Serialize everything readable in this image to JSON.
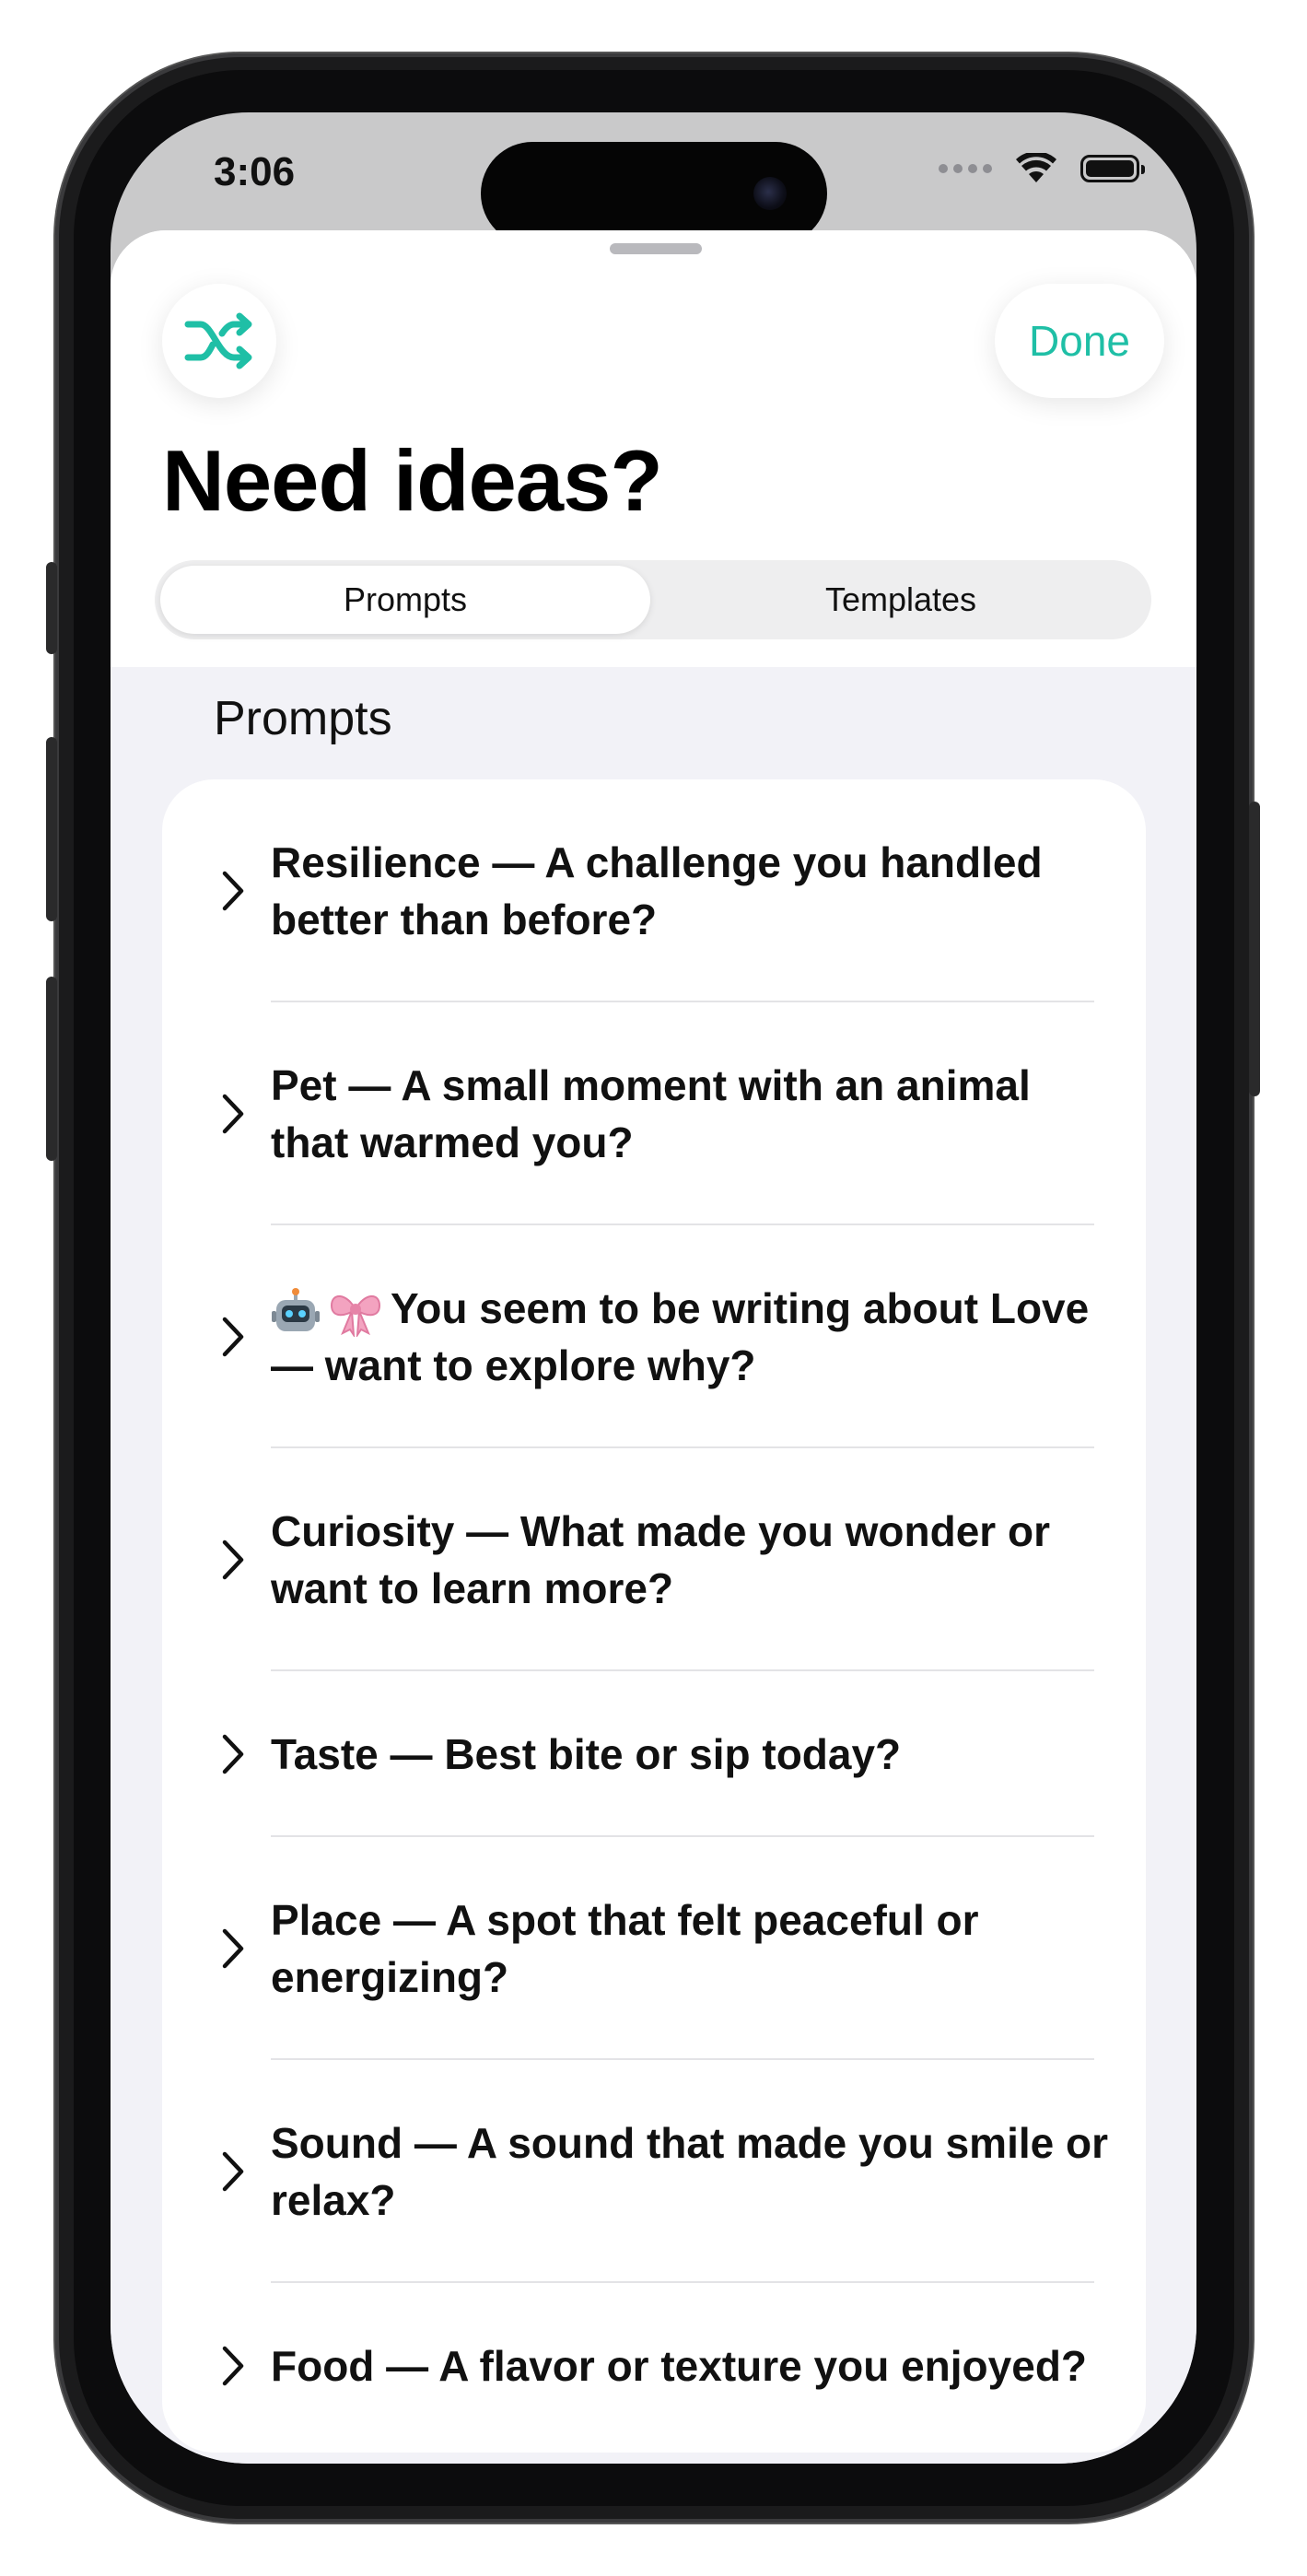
{
  "status_bar": {
    "time": "3:06"
  },
  "header": {
    "shuffle_icon": "shuffle-icon",
    "done_label": "Done",
    "title": "Need ideas?",
    "accent_color": "#1fbfa6"
  },
  "tabs": [
    {
      "label": "Prompts",
      "selected": true
    },
    {
      "label": "Templates",
      "selected": false
    }
  ],
  "section": {
    "title": "Prompts"
  },
  "prompts": [
    {
      "text": "Resilience — A challenge you handled better than before?"
    },
    {
      "text": "Pet — A small moment with an animal that warmed you?"
    },
    {
      "text": "You seem to be writing about Love — want to explore why?",
      "emoji": [
        "robot-icon",
        "bow-icon"
      ]
    },
    {
      "text": "Curiosity — What made you wonder or want to learn more?"
    },
    {
      "text": "Taste — Best bite or sip today?"
    },
    {
      "text": "Place — A spot that felt peaceful or energizing?"
    },
    {
      "text": "Sound — A sound that made you smile or relax?"
    },
    {
      "text": "Food — A flavor or texture you enjoyed?"
    }
  ]
}
